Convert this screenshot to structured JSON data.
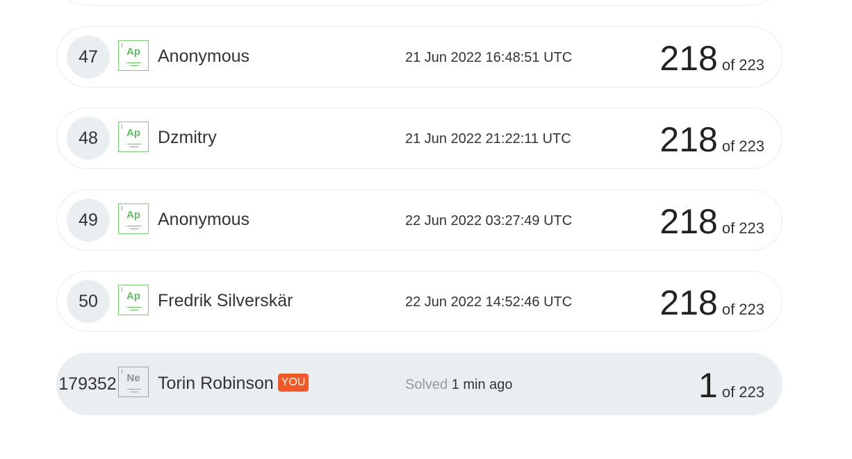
{
  "leaderboard": {
    "rows": [
      {
        "rank": "47",
        "level": "Ap",
        "name": "Anonymous",
        "date": "21 Jun 2022 16:48:51 UTC",
        "solved": "218",
        "of_total": "of 223"
      },
      {
        "rank": "48",
        "level": "Ap",
        "name": "Dzmitry",
        "date": "21 Jun 2022 21:22:11 UTC",
        "solved": "218",
        "of_total": "of 223"
      },
      {
        "rank": "49",
        "level": "Ap",
        "name": "Anonymous",
        "date": "22 Jun 2022 03:27:49 UTC",
        "solved": "218",
        "of_total": "of 223"
      },
      {
        "rank": "50",
        "level": "Ap",
        "name": "Fredrik Silverskär",
        "date": "22 Jun 2022 14:52:46 UTC",
        "solved": "218",
        "of_total": "of 223"
      }
    ],
    "current_user": {
      "rank": "179352",
      "level": "Ne",
      "name": "Torin Robinson",
      "badge": "YOU",
      "solved_label": "Solved",
      "solved_time": "1 min ago",
      "solved": "1",
      "of_total": "of 223"
    }
  },
  "colors": {
    "level_green": "#66bb66",
    "you_badge": "#f05a28",
    "you_row_bg": "#e9eef1"
  }
}
